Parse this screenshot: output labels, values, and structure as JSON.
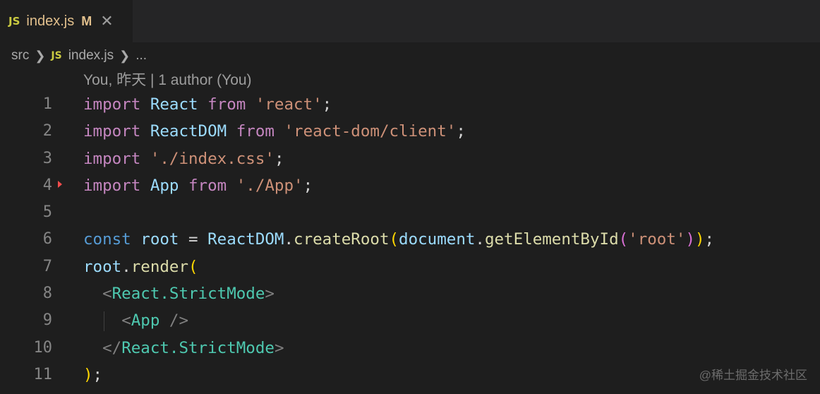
{
  "tab": {
    "badge": "JS",
    "name": "index.js",
    "modified": "M",
    "close": "✕"
  },
  "breadcrumb": {
    "folder": "src",
    "js_badge": "JS",
    "file": "index.js",
    "more": "..."
  },
  "codelens": "You, 昨天 | 1 author (You)",
  "lines": [
    {
      "n": "1",
      "tokens": [
        {
          "t": "import",
          "c": "kw"
        },
        {
          "t": " "
        },
        {
          "t": "React",
          "c": "var"
        },
        {
          "t": " "
        },
        {
          "t": "from",
          "c": "kw"
        },
        {
          "t": " "
        },
        {
          "t": "'react'",
          "c": "str"
        },
        {
          "t": ";"
        }
      ]
    },
    {
      "n": "2",
      "tokens": [
        {
          "t": "import",
          "c": "kw"
        },
        {
          "t": " "
        },
        {
          "t": "ReactDOM",
          "c": "var"
        },
        {
          "t": " "
        },
        {
          "t": "from",
          "c": "kw"
        },
        {
          "t": " "
        },
        {
          "t": "'react-dom/client'",
          "c": "str"
        },
        {
          "t": ";"
        }
      ]
    },
    {
      "n": "3",
      "tokens": [
        {
          "t": "import",
          "c": "kw"
        },
        {
          "t": " "
        },
        {
          "t": "'./index.css'",
          "c": "str"
        },
        {
          "t": ";"
        }
      ]
    },
    {
      "n": "4",
      "mark": true,
      "tokens": [
        {
          "t": "import",
          "c": "kw"
        },
        {
          "t": " "
        },
        {
          "t": "App",
          "c": "var"
        },
        {
          "t": " "
        },
        {
          "t": "from",
          "c": "kw"
        },
        {
          "t": " "
        },
        {
          "t": "'./App'",
          "c": "str"
        },
        {
          "t": ";"
        }
      ]
    },
    {
      "n": "5",
      "tokens": []
    },
    {
      "n": "6",
      "tokens": [
        {
          "t": "const",
          "c": "storage"
        },
        {
          "t": " "
        },
        {
          "t": "root",
          "c": "var"
        },
        {
          "t": " = "
        },
        {
          "t": "ReactDOM",
          "c": "var"
        },
        {
          "t": "."
        },
        {
          "t": "createRoot",
          "c": "fn"
        },
        {
          "t": "(",
          "c": "br1"
        },
        {
          "t": "document",
          "c": "var"
        },
        {
          "t": "."
        },
        {
          "t": "getElementById",
          "c": "fn"
        },
        {
          "t": "(",
          "c": "br2"
        },
        {
          "t": "'root'",
          "c": "str"
        },
        {
          "t": ")",
          "c": "br2"
        },
        {
          "t": ")",
          "c": "br1"
        },
        {
          "t": ";"
        }
      ]
    },
    {
      "n": "7",
      "tokens": [
        {
          "t": "root",
          "c": "var"
        },
        {
          "t": "."
        },
        {
          "t": "render",
          "c": "fn"
        },
        {
          "t": "(",
          "c": "br1"
        }
      ]
    },
    {
      "n": "8",
      "tokens": [
        {
          "t": "  "
        },
        {
          "t": "<",
          "c": "tagb"
        },
        {
          "t": "React.StrictMode",
          "c": "cls"
        },
        {
          "t": ">",
          "c": "tagb"
        }
      ]
    },
    {
      "n": "9",
      "guide": true,
      "tokens": [
        {
          "t": "    "
        },
        {
          "t": "<",
          "c": "tagb"
        },
        {
          "t": "App",
          "c": "cls"
        },
        {
          "t": " "
        },
        {
          "t": "/>",
          "c": "tagb"
        }
      ]
    },
    {
      "n": "10",
      "tokens": [
        {
          "t": "  "
        },
        {
          "t": "</",
          "c": "tagb"
        },
        {
          "t": "React.StrictMode",
          "c": "cls"
        },
        {
          "t": ">",
          "c": "tagb"
        }
      ]
    },
    {
      "n": "11",
      "tokens": [
        {
          "t": ")",
          "c": "br1"
        },
        {
          "t": ";"
        }
      ]
    }
  ],
  "watermark": "@稀土掘金技术社区"
}
